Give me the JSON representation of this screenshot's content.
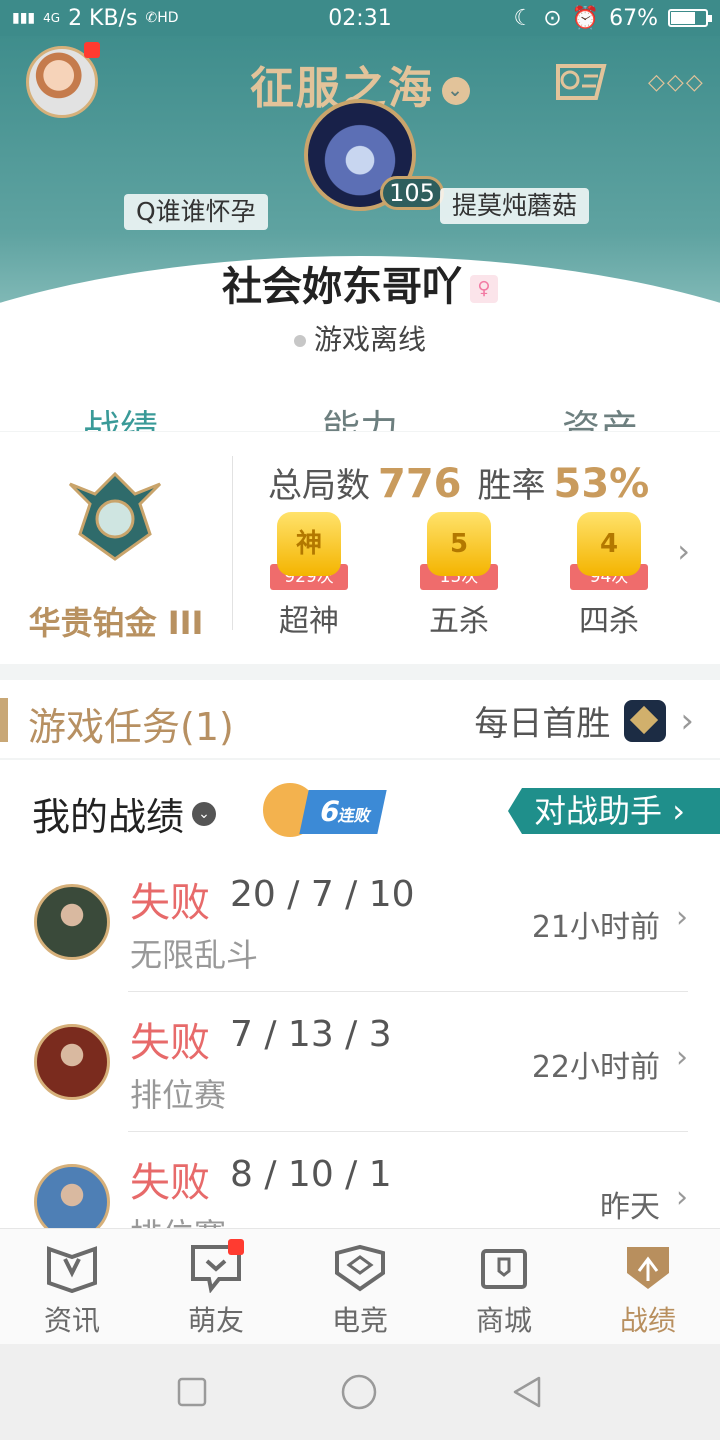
{
  "status_bar": {
    "network": "4G",
    "speed": "2 KB/s",
    "hd": "HD",
    "time": "02:31",
    "battery": "67%",
    "battery_level": 0.67
  },
  "header": {
    "game_title": "征服之海",
    "level": "105",
    "left_tag": "Q谁谁怀孕",
    "right_tag": "提莫炖蘑菇",
    "nickname": "社会妳东哥吖",
    "status": "游戏离线"
  },
  "tabs": [
    {
      "label": "战绩",
      "active": true
    },
    {
      "label": "能力",
      "active": false
    },
    {
      "label": "资产",
      "active": false
    }
  ],
  "rank_card": {
    "tier": "华贵铂金 III",
    "total_label": "总局数",
    "total_value": "776",
    "winrate_label": "胜率",
    "winrate_value": "53%",
    "medals": [
      {
        "symbol": "神",
        "count": "929次",
        "name": "超神"
      },
      {
        "symbol": "5",
        "count": "15次",
        "name": "五杀"
      },
      {
        "symbol": "4",
        "count": "94次",
        "name": "四杀"
      }
    ]
  },
  "tasks": {
    "title": "游戏任务(1)",
    "right_label": "每日首胜"
  },
  "records": {
    "title": "我的战绩",
    "streak_number": "6",
    "streak_text": "连败",
    "assistant_label": "对战助手",
    "matches": [
      {
        "result": "失败",
        "kda": "20 / 7 / 10",
        "mode": "无限乱斗",
        "time": "21小时前",
        "hero_color": "#3a4a3a"
      },
      {
        "result": "失败",
        "kda": "7 / 13 / 3",
        "mode": "排位赛",
        "time": "22小时前",
        "hero_color": "#7a2b1e"
      },
      {
        "result": "失败",
        "kda": "8 / 10 / 1",
        "mode": "排位赛",
        "time": "昨天",
        "hero_color": "#4e7fb5"
      }
    ]
  },
  "bottom_nav": [
    {
      "label": "资讯",
      "active": false
    },
    {
      "label": "萌友",
      "active": false
    },
    {
      "label": "电竞",
      "active": false
    },
    {
      "label": "商城",
      "active": false
    },
    {
      "label": "战绩",
      "active": true
    }
  ],
  "colors": {
    "teal": "#3f8d8c",
    "gold": "#c99b5d",
    "loss_red": "#e76a6a"
  }
}
